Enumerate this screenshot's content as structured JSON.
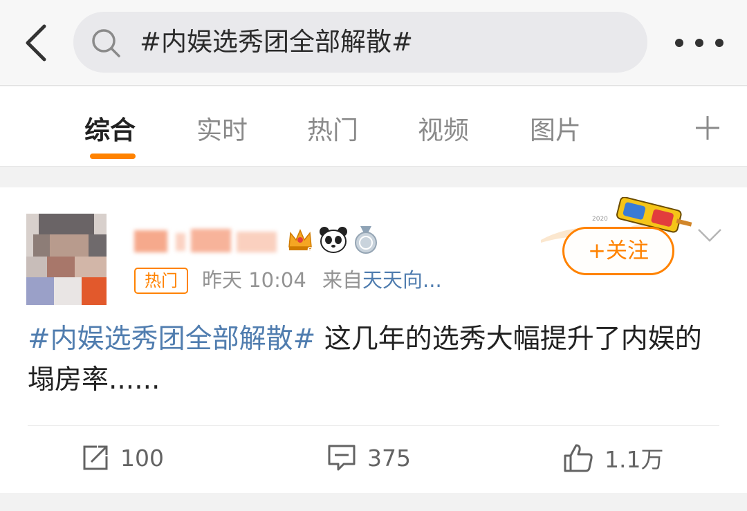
{
  "search": {
    "query": "#内娱选秀团全部解散#"
  },
  "tabs": [
    {
      "label": "综合",
      "active": true
    },
    {
      "label": "实时"
    },
    {
      "label": "热门"
    },
    {
      "label": "视频"
    },
    {
      "label": "图片"
    }
  ],
  "post": {
    "hot_tag": "热门",
    "time": "昨天 10:04",
    "source_prefix": "来自",
    "source": "天天向...",
    "follow_label": "+关注",
    "topic": "#内娱选秀团全部解散#",
    "text": " 这几年的选秀大幅提升了内娱的塌房率......",
    "actions": {
      "repost_count": "100",
      "comment_count": "375",
      "like_count": "1.1万"
    }
  },
  "colors": {
    "accent": "#ff8200",
    "link": "#507daf"
  },
  "icons": [
    "back-arrow-icon",
    "search-icon",
    "more-dots-icon",
    "plus-icon",
    "crown-badge-icon",
    "panda-badge-icon",
    "medal-badge-icon",
    "chevron-down-icon",
    "repost-icon",
    "comment-icon",
    "like-icon"
  ]
}
